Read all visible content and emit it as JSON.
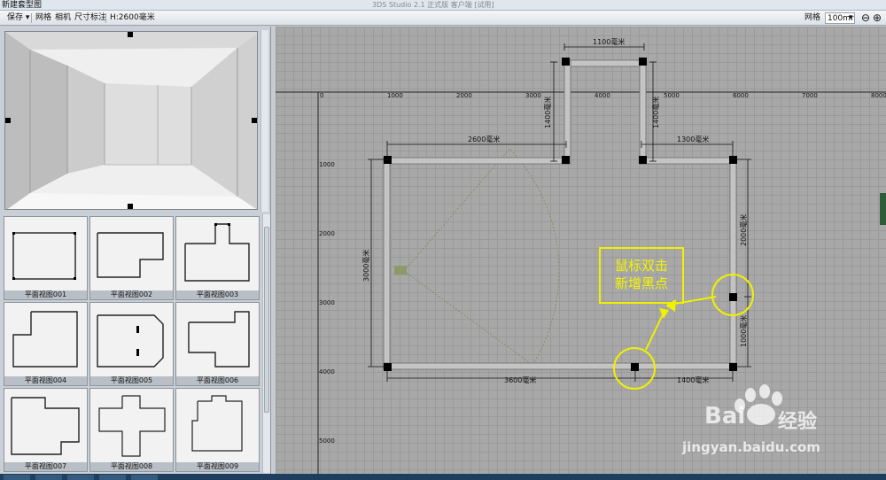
{
  "window": {
    "title": "新建套型图",
    "subtitle": "3DS Studio 2.1 正式版 客户端 [试用]"
  },
  "toolbar": {
    "save_label": "保存",
    "save_arrow": "▾",
    "grid_label": "网格",
    "camera_label": "相机",
    "dimension_label": "尺寸标注",
    "height_label": "H:2600毫米",
    "grid_right_label": "网格",
    "grid_size_value": "100mr",
    "grid_size_arrow": "▾",
    "zoom_out_icon": "⊖",
    "zoom_in_icon": "⊕"
  },
  "thumbnails": [
    {
      "label": "平面视图001"
    },
    {
      "label": "平面视图002"
    },
    {
      "label": "平面视图003"
    },
    {
      "label": "平面视图004"
    },
    {
      "label": "平面视图005"
    },
    {
      "label": "平面视图006"
    },
    {
      "label": "平面视图007"
    },
    {
      "label": "平面视图008"
    },
    {
      "label": "平面视图009"
    }
  ],
  "ruler": {
    "x_ticks": [
      "0",
      "1000",
      "2000",
      "3000",
      "4000",
      "5000",
      "6000",
      "7000",
      "8000"
    ],
    "y_ticks": [
      "1000",
      "2000",
      "3000",
      "4000",
      "5000"
    ]
  },
  "dimensions": {
    "top_width": "1100毫米",
    "left_top_height": "1400毫米",
    "right_top_height": "1400毫米",
    "top_left_width": "2600毫米",
    "top_right_width": "1300毫米",
    "left_height": "3000毫米",
    "right_upper_height": "2000毫米",
    "right_lower_height": "1000毫米",
    "bottom_left_width": "3600毫米",
    "bottom_right_width": "1400毫米"
  },
  "annotation": {
    "line1": "鼠标双击",
    "line2": "新增黑点"
  },
  "watermark": {
    "brand": "Bai",
    "brand2": "经验",
    "url": "jingyan.baidu.com"
  },
  "colors": {
    "annotation": "#f0f000",
    "wall": "#b8b8b8",
    "canvas_bg": "#a8a8a8"
  }
}
